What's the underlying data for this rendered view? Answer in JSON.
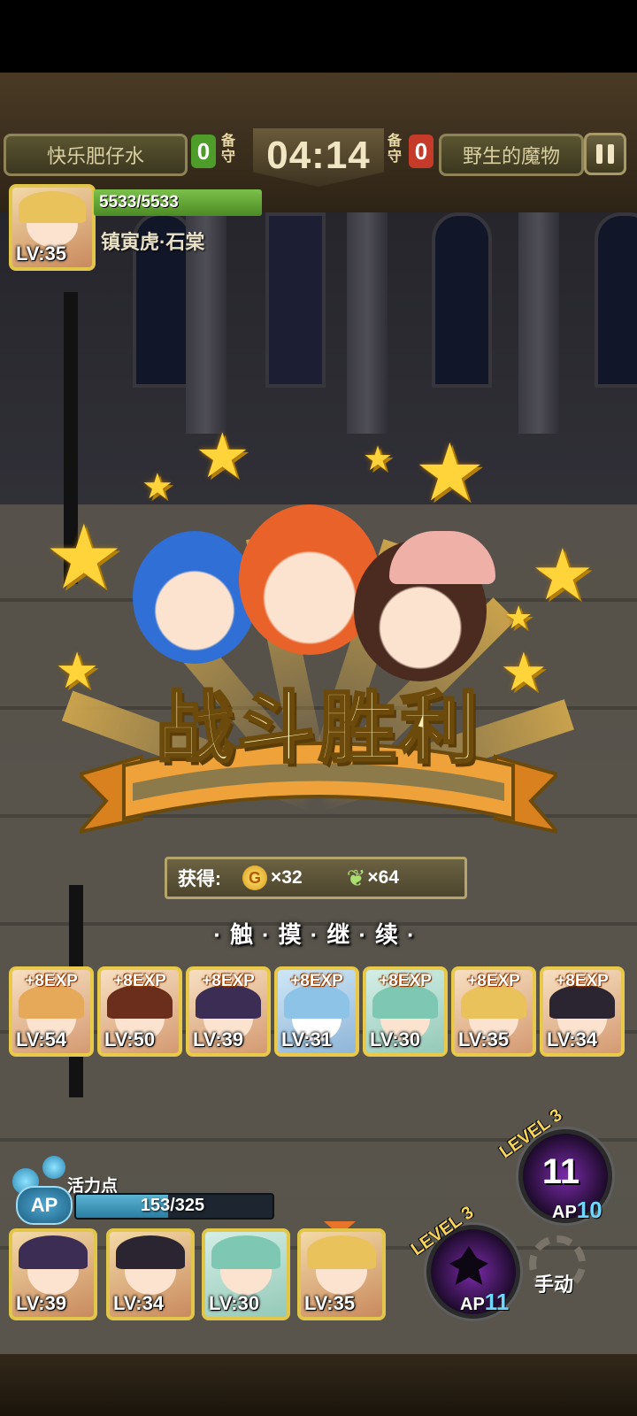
{
  "header": {
    "player_name": "快乐肥仔水",
    "player_score": "0",
    "guard_label": "备守",
    "timer": "04:14",
    "enemy_score": "0",
    "enemy_name": "野生的魔物"
  },
  "hero": {
    "hp": "5533/5533",
    "name": "镇寅虎·石棠",
    "level": "LV:35"
  },
  "victory": {
    "title": "战斗胜利",
    "reward_label": "获得:",
    "gold": "×32",
    "feather": "×64",
    "tap_continue": "·触·摸·继·续·"
  },
  "exp_cards": [
    {
      "exp": "+8EXP",
      "level": "LV:54"
    },
    {
      "exp": "+8EXP",
      "level": "LV:50"
    },
    {
      "exp": "+8EXP",
      "level": "LV:39"
    },
    {
      "exp": "+8EXP",
      "level": "LV:31"
    },
    {
      "exp": "+8EXP",
      "level": "LV:30"
    },
    {
      "exp": "+8EXP",
      "level": "LV:35"
    },
    {
      "exp": "+8EXP",
      "level": "LV:34"
    }
  ],
  "ap": {
    "label": "活力点",
    "badge": "AP",
    "value": "153/325",
    "fill_fraction": 0.47
  },
  "team": [
    {
      "level": "LV:39"
    },
    {
      "level": "LV:34"
    },
    {
      "level": "LV:30"
    },
    {
      "level": "LV:35"
    }
  ],
  "skills": {
    "skill1": {
      "level": "LEVEL 3",
      "count": "11",
      "ap_label": "AP",
      "ap_value": "10"
    },
    "skill2": {
      "level": "LEVEL 3",
      "ap_label": "AP",
      "ap_value": "11"
    },
    "manual": "手动"
  },
  "colors": {
    "gold": "#e8c94a",
    "accent_blue": "#6fd7ff",
    "hp_green": "#7cc04c"
  }
}
